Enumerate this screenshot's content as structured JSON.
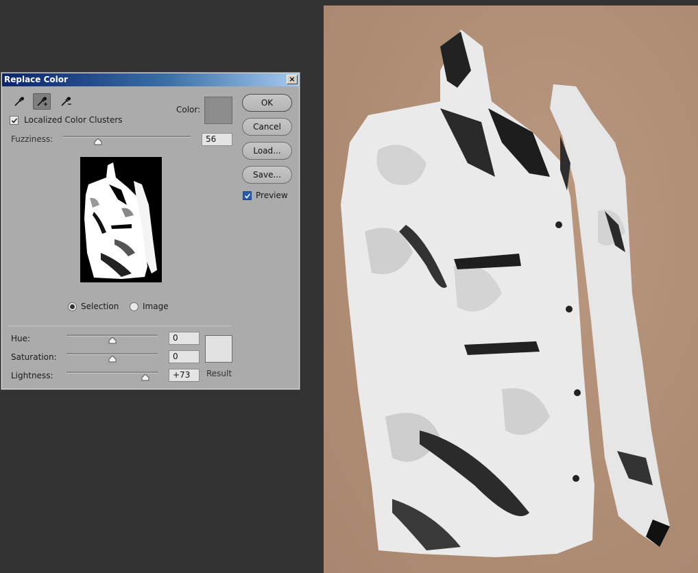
{
  "dialog": {
    "title": "Replace Color",
    "close_glyph": "×",
    "tools": [
      "eyedropper-icon",
      "eyedropper-plus-icon",
      "eyedropper-minus-icon"
    ],
    "color_label": "Color:",
    "localized_label": "Localized Color Clusters",
    "localized_checked": true,
    "fuzziness_label": "Fuzziness:",
    "fuzziness_value": "56",
    "view_options": {
      "selection": "Selection",
      "image": "Image",
      "selected": "selection"
    },
    "hue_label": "Hue:",
    "hue_value": "0",
    "saturation_label": "Saturation:",
    "saturation_value": "0",
    "lightness_label": "Lightness:",
    "lightness_value": "+73",
    "result_label": "Result",
    "buttons": {
      "ok": "OK",
      "cancel": "Cancel",
      "load": "Load...",
      "save": "Save..."
    },
    "preview_label": "Preview",
    "preview_checked": true
  },
  "colors": {
    "selection_color": "#8c8c8c",
    "result_color": "#e2e2e2",
    "canvas_background": "#b28f78"
  }
}
